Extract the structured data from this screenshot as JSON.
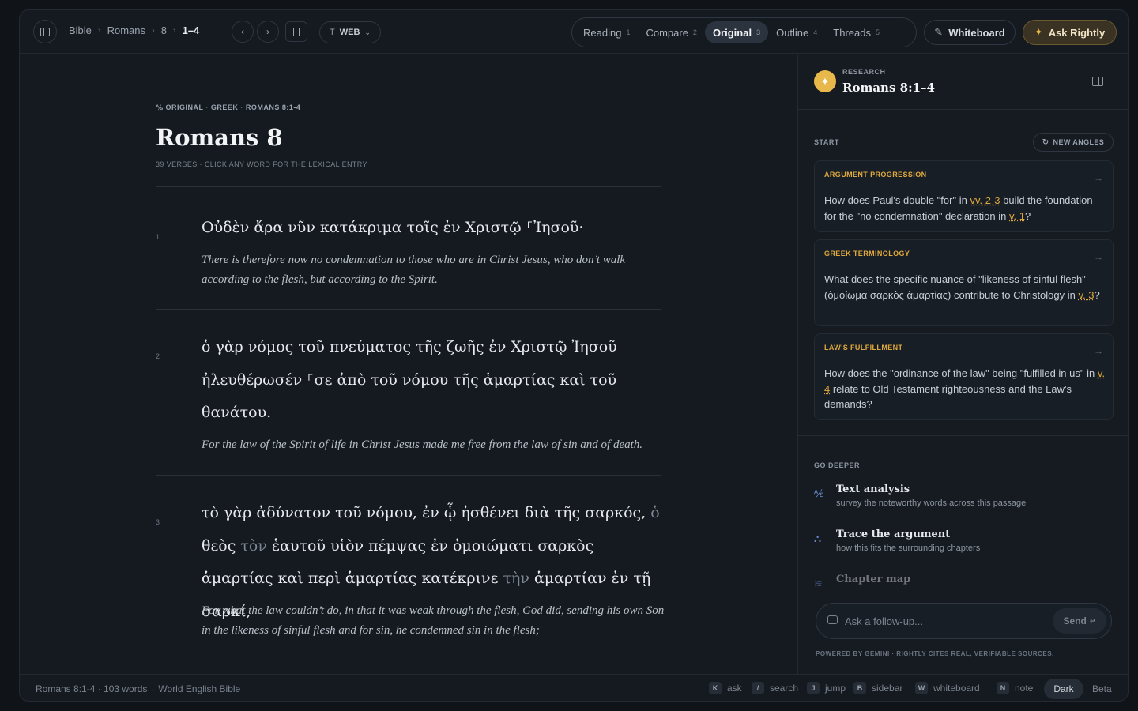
{
  "topbar": {
    "breadcrumbs": [
      "Bible",
      "Romans",
      "8",
      "1–4"
    ],
    "translation": "WEB",
    "tabs": [
      {
        "label": "Reading",
        "num": "1",
        "active": false
      },
      {
        "label": "Compare",
        "num": "2",
        "active": false
      },
      {
        "label": "Original",
        "num": "3",
        "active": true
      },
      {
        "label": "Outline",
        "num": "4",
        "active": false
      },
      {
        "label": "Threads",
        "num": "5",
        "active": false
      }
    ],
    "whiteboard_label": "Whiteboard",
    "ask_label": "Ask Rightly"
  },
  "main": {
    "kicker": "ORIGINAL · GREEK · ROMANS 8:1-4",
    "title": "Romans 8",
    "subtitle": "39 VERSES · CLICK ANY WORD FOR THE LEXICAL ENTRY",
    "verses": [
      {
        "num": "1",
        "greek": "Οὐδὲν ἄρα νῦν κατάκριμα τοῖς ἐν Χριστῷ ⸀Ἰησοῦ·",
        "english": "There is therefore now no condemnation to those who are in Christ Jesus, who don’t walk according to the flesh, but according to the Spirit."
      },
      {
        "num": "2",
        "greek": "ὁ γὰρ νόμος τοῦ πνεύματος τῆς ζωῆς ἐν Χριστῷ Ἰησοῦ ἠλευθέρωσέν ⸀σε ἀπὸ τοῦ νόμου τῆς ἁμαρτίας καὶ τοῦ θανάτου.",
        "english": "For the law of the Spirit of life in Christ Jesus made me free from the law of sin and of death."
      },
      {
        "num": "3",
        "greek_parts": [
          {
            "t": "τὸ γὰρ ἀδύνατον τοῦ νόμου, ἐν ᾧ ἠσθένει διὰ τῆς σαρκός, ",
            "dim": false
          },
          {
            "t": "ὁ",
            "dim": true
          },
          {
            "t": " θεὸς ",
            "dim": false
          },
          {
            "t": "τὸν",
            "dim": true
          },
          {
            "t": " ἑαυτοῦ υἱὸν πέμψας ἐν ὁμοιώματι σαρκὸς ἁμαρτίας καὶ περὶ ἁμαρτίας κατέκρινε ",
            "dim": false
          },
          {
            "t": "τὴν",
            "dim": true
          },
          {
            "t": " ἁμαρτίαν ἐν τῇ σαρκί,",
            "dim": false
          }
        ],
        "english": "For what the law couldn’t do, in that it was weak through the flesh, God did, sending his own Son in the likeness of sinful flesh and for sin, he condemned sin in the flesh;"
      }
    ]
  },
  "sidebar": {
    "label": "RESEARCH",
    "title": "Romans 8:1–4",
    "start_label": "START",
    "new_angles": "NEW ANGLES",
    "cards": [
      {
        "label": "ARGUMENT PROGRESSION",
        "parts": [
          {
            "t": "How does Paul's double \"for\" in ",
            "ref": false
          },
          {
            "t": "vv. 2-3",
            "ref": true
          },
          {
            "t": " build the foundation for the \"no condemnation\" declaration in ",
            "ref": false
          },
          {
            "t": "v. 1",
            "ref": true
          },
          {
            "t": "?",
            "ref": false
          }
        ]
      },
      {
        "label": "GREEK TERMINOLOGY",
        "parts": [
          {
            "t": "What does the specific nuance of \"likeness of sinful flesh\" (ὁμοίωμα σαρκὸς ἁμαρτίας) contribute to Christology in ",
            "ref": false
          },
          {
            "t": "v. 3",
            "ref": true
          },
          {
            "t": "?",
            "ref": false
          }
        ]
      },
      {
        "label": "LAW'S FULFILLMENT",
        "parts": [
          {
            "t": "How does the \"ordinance of the law\" being \"fulfilled in us\" in ",
            "ref": false
          },
          {
            "t": "v. 4",
            "ref": true
          },
          {
            "t": " relate to Old Testament righteousness and the Law's demands?",
            "ref": false
          }
        ]
      }
    ],
    "go_deeper_label": "GO DEEPER",
    "deeper": [
      {
        "title": "Text analysis",
        "desc": "survey the noteworthy words across this passage",
        "icon": "translate-icon"
      },
      {
        "title": "Trace the argument",
        "desc": "how this fits the surrounding chapters",
        "icon": "hierarchy-icon"
      },
      {
        "title": "Chapter map",
        "desc": "",
        "icon": "layers-icon"
      }
    ],
    "followup_placeholder": "Ask a follow-up...",
    "send_label": "Send",
    "powered": "POWERED BY GEMINI · RIGHTLY CITES REAL, VERIFIABLE SOURCES."
  },
  "footer": {
    "passage": "Romans 8:1-4 · 103 words",
    "version": "World English Bible",
    "shortcuts": [
      {
        "key": "K",
        "label": "ask"
      },
      {
        "key": "/",
        "label": "search"
      },
      {
        "key": "J",
        "label": "jump"
      },
      {
        "key": "B",
        "label": "sidebar"
      },
      {
        "key": "W",
        "label": "whiteboard"
      },
      {
        "key": "N",
        "label": "note"
      }
    ],
    "theme": "Dark",
    "beta": "Beta"
  },
  "colors": {
    "accent": "#e0a93c",
    "background": "#151a21",
    "ask_button": "#3a3222"
  }
}
